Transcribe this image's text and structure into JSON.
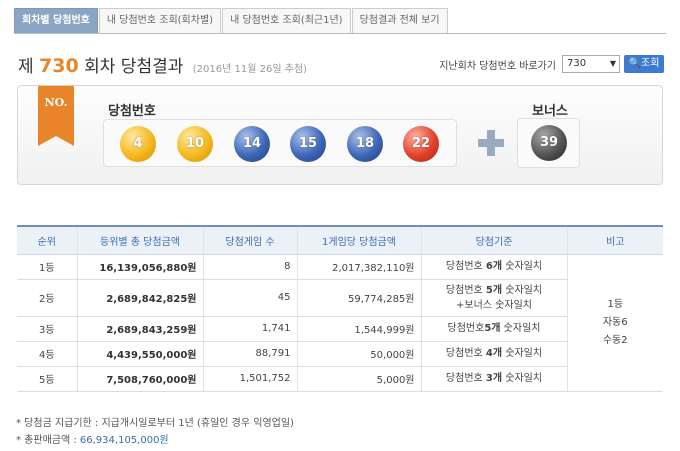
{
  "tabs": [
    "회차별 당첨번호",
    "내 당첨번호 조회(회차별)",
    "내 당첨번호 조회(최근1년)",
    "당첨결과 전체 보기"
  ],
  "title": {
    "prefix": "제",
    "round": "730",
    "suffix": "회차 당첨결과",
    "date": "(2016년 11월 26일 추첨)"
  },
  "goto": {
    "label": "지난회차 당첨번호 바로가기",
    "selected": "730",
    "button": "조회"
  },
  "ribbon": "NO.",
  "win_label": "당첨번호",
  "bonus_label": "보너스",
  "balls": [
    {
      "value": "4",
      "color": "yellow"
    },
    {
      "value": "10",
      "color": "yellow"
    },
    {
      "value": "14",
      "color": "blue"
    },
    {
      "value": "15",
      "color": "blue"
    },
    {
      "value": "18",
      "color": "blue"
    },
    {
      "value": "22",
      "color": "red"
    }
  ],
  "bonus_ball": {
    "value": "39",
    "color": "gray"
  },
  "table": {
    "headers": [
      "순위",
      "등위별 총 당첨금액",
      "당첨게임 수",
      "1게임당 당첨금액",
      "당첨기준",
      "비고"
    ],
    "rows": [
      {
        "rank": "1등",
        "total": "16,139,056,880원",
        "games": "8",
        "per_game": "2,017,382,110원",
        "criteria_a": "당첨번호 ",
        "criteria_b": "6개",
        "criteria_c": " 숫자일치",
        "criteria_d": ""
      },
      {
        "rank": "2등",
        "total": "2,689,842,825원",
        "games": "45",
        "per_game": "59,774,285원",
        "criteria_a": "당첨번호 ",
        "criteria_b": "5개",
        "criteria_c": " 숫자일치",
        "criteria_d": "+보너스 숫자일치"
      },
      {
        "rank": "3등",
        "total": "2,689,843,259원",
        "games": "1,741",
        "per_game": "1,544,999원",
        "criteria_a": "당첨번호",
        "criteria_b": "5개",
        "criteria_c": " 숫자일치",
        "criteria_d": ""
      },
      {
        "rank": "4등",
        "total": "4,439,550,000원",
        "games": "88,791",
        "per_game": "50,000원",
        "criteria_a": "당첨번호 ",
        "criteria_b": "4개",
        "criteria_c": " 숫자일치",
        "criteria_d": ""
      },
      {
        "rank": "5등",
        "total": "7,508,760,000원",
        "games": "1,501,752",
        "per_game": "5,000원",
        "criteria_a": "당첨번호 ",
        "criteria_b": "3개",
        "criteria_c": " 숫자일치",
        "criteria_d": ""
      }
    ],
    "note_lines": [
      "1등",
      "자동6",
      "수동2"
    ]
  },
  "footer": {
    "deadline": "* 당첨금 지급기한 : 지급개시일로부터 1년 (휴일인 경우 익영업일)",
    "sales_label": "* 총판매금액 : ",
    "sales_amount": "66,934,105,000원"
  }
}
